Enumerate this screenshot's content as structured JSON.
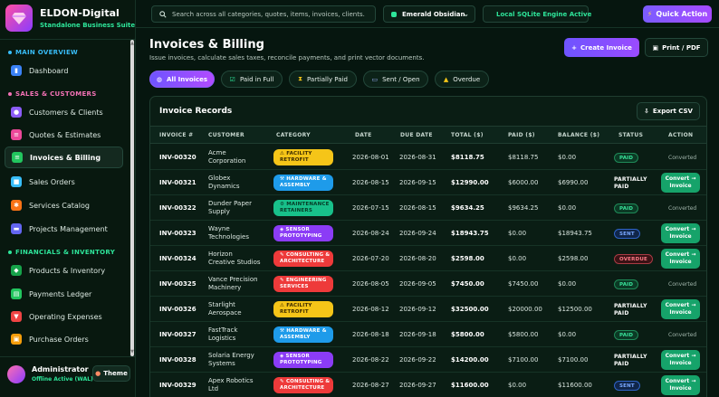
{
  "brand": {
    "title": "ELDON-Digital",
    "subtitle": "Standalone Business Suite"
  },
  "sidebar": {
    "sections": [
      {
        "label": "MAIN OVERVIEW",
        "color": "#38bdf8",
        "items": [
          {
            "label": "Dashboard",
            "icon": "chart-icon",
            "color": "#3b82f6"
          }
        ]
      },
      {
        "label": "SALES & CUSTOMERS",
        "color": "#f472b6",
        "items": [
          {
            "label": "Customers & Clients",
            "icon": "users-icon",
            "color": "#8b5cf6"
          },
          {
            "label": "Quotes & Estimates",
            "icon": "quote-icon",
            "color": "#ec4899"
          },
          {
            "label": "Invoices & Billing",
            "icon": "invoice-icon",
            "color": "#22c55e",
            "active": true
          },
          {
            "label": "Sales Orders",
            "icon": "box-icon",
            "color": "#38bdf8"
          },
          {
            "label": "Services Catalog",
            "icon": "gear-icon",
            "color": "#f97316"
          },
          {
            "label": "Projects Management",
            "icon": "folder-icon",
            "color": "#6366f1"
          }
        ]
      },
      {
        "label": "FINANCIALS & INVENTORY",
        "color": "#2ee59a",
        "items": [
          {
            "label": "Products & Inventory",
            "icon": "package-icon",
            "color": "#16a34a"
          },
          {
            "label": "Payments Ledger",
            "icon": "ledger-icon",
            "color": "#22c55e"
          },
          {
            "label": "Operating Expenses",
            "icon": "expense-icon",
            "color": "#ef4444"
          },
          {
            "label": "Purchase Orders",
            "icon": "cart-icon",
            "color": "#f59e0b"
          }
        ]
      }
    ]
  },
  "user": {
    "name": "Administrator",
    "status": "Offline Active (WAL)",
    "theme_label": "Theme"
  },
  "topbar": {
    "search_placeholder": "Search across all categories, quotes, items, invoices, clients.",
    "theme_value": "Emerald Obsidian",
    "engine_label": "Local SQLite Engine Active",
    "quick_action": "Quick Action"
  },
  "header": {
    "title": "Invoices & Billing",
    "subtitle": "Issue invoices, calculate sales taxes, reconcile payments, and print vector documents.",
    "create_label": "Create Invoice",
    "print_label": "Print / PDF"
  },
  "filters": [
    {
      "label": "All Invoices",
      "active": true
    },
    {
      "label": "Paid in Full"
    },
    {
      "label": "Partially Paid"
    },
    {
      "label": "Sent / Open"
    },
    {
      "label": "Overdue"
    }
  ],
  "table": {
    "title": "Invoice Records",
    "export_label": "Export CSV",
    "columns": [
      "INVOICE #",
      "CUSTOMER",
      "CATEGORY",
      "DATE",
      "DUE DATE",
      "TOTAL ($)",
      "PAID ($)",
      "BALANCE ($)",
      "STATUS",
      "ACTION"
    ],
    "convert_label": "Convert → Invoice",
    "converted_label": "Converted",
    "rows": [
      {
        "id": "INV-00320",
        "customer": "Acme Corporation",
        "category": "FACILITY RETROFIT",
        "cat_style": "yellow",
        "date": "2026-08-01",
        "due": "2026-08-31",
        "total": "$8118.75",
        "paid": "$8118.75",
        "balance": "$0.00",
        "status": "PAID",
        "status_style": "paid",
        "action": "converted"
      },
      {
        "id": "INV-00321",
        "customer": "Globex Dynamics",
        "category": "HARDWARE & ASSEMBLY",
        "cat_style": "blue",
        "date": "2026-08-15",
        "due": "2026-09-15",
        "total": "$12990.00",
        "paid": "$6000.00",
        "balance": "$6990.00",
        "status": "PARTIALLY PAID",
        "status_style": "partial",
        "action": "convert"
      },
      {
        "id": "INV-00322",
        "customer": "Dunder Paper Supply",
        "category": "MAINTENANCE RETAINERS",
        "cat_style": "green",
        "date": "2026-07-15",
        "due": "2026-08-15",
        "total": "$9634.25",
        "paid": "$9634.25",
        "balance": "$0.00",
        "status": "PAID",
        "status_style": "paid",
        "action": "converted"
      },
      {
        "id": "INV-00323",
        "customer": "Wayne Technologies",
        "category": "SENSOR PROTOTYPING",
        "cat_style": "purple",
        "date": "2026-08-24",
        "due": "2026-09-24",
        "total": "$18943.75",
        "paid": "$0.00",
        "balance": "$18943.75",
        "status": "SENT",
        "status_style": "sent",
        "action": "convert"
      },
      {
        "id": "INV-00324",
        "customer": "Horizon Creative Studios",
        "category": "CONSULTING & ARCHITECTURE",
        "cat_style": "red",
        "date": "2026-07-20",
        "due": "2026-08-20",
        "total": "$2598.00",
        "paid": "$0.00",
        "balance": "$2598.00",
        "status": "OVERDUE",
        "status_style": "overdue",
        "action": "convert"
      },
      {
        "id": "INV-00325",
        "customer": "Vance Precision Machinery",
        "category": "ENGINEERING SERVICES",
        "cat_style": "red",
        "date": "2026-08-05",
        "due": "2026-09-05",
        "total": "$7450.00",
        "paid": "$7450.00",
        "balance": "$0.00",
        "status": "PAID",
        "status_style": "paid",
        "action": "converted"
      },
      {
        "id": "INV-00326",
        "customer": "Starlight Aerospace",
        "category": "FACILITY RETROFIT",
        "cat_style": "yellow",
        "date": "2026-08-12",
        "due": "2026-09-12",
        "total": "$32500.00",
        "paid": "$20000.00",
        "balance": "$12500.00",
        "status": "PARTIALLY PAID",
        "status_style": "partial",
        "action": "convert"
      },
      {
        "id": "INV-00327",
        "customer": "FastTrack Logistics",
        "category": "HARDWARE & ASSEMBLY",
        "cat_style": "blue",
        "date": "2026-08-18",
        "due": "2026-09-18",
        "total": "$5800.00",
        "paid": "$5800.00",
        "balance": "$0.00",
        "status": "PAID",
        "status_style": "paid",
        "action": "converted"
      },
      {
        "id": "INV-00328",
        "customer": "Solaria Energy Systems",
        "category": "SENSOR PROTOTYPING",
        "cat_style": "purple",
        "date": "2026-08-22",
        "due": "2026-09-22",
        "total": "$14200.00",
        "paid": "$7100.00",
        "balance": "$7100.00",
        "status": "PARTIALLY PAID",
        "status_style": "partial",
        "action": "convert"
      },
      {
        "id": "INV-00329",
        "customer": "Apex Robotics Ltd",
        "category": "CONSULTING & ARCHITECTURE",
        "cat_style": "red",
        "date": "2026-08-27",
        "due": "2026-09-27",
        "total": "$11600.00",
        "paid": "$0.00",
        "balance": "$11600.00",
        "status": "SENT",
        "status_style": "sent",
        "action": "convert"
      }
    ]
  },
  "colors": {
    "accent": "#2ee59a",
    "primary_gradient_start": "#6e54ff",
    "primary_gradient_end": "#a64bff",
    "cat_yellow": "#f5c518",
    "cat_blue": "#1e9bea",
    "cat_green": "#18c08a",
    "cat_purple": "#8b3cf6",
    "cat_red": "#ee3a3a"
  }
}
